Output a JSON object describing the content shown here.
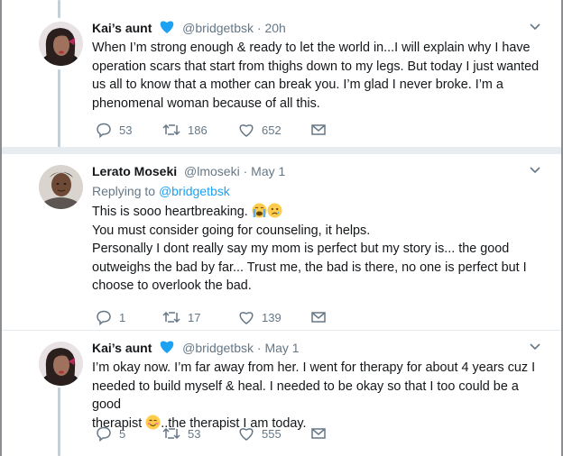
{
  "tweets": [
    {
      "author_name": "Kai’s aunt",
      "verified_badge_icon": "heart-icon",
      "handle": "@bridgetbsk",
      "separator": "·",
      "time": "20h",
      "lines": [
        "When I’m strong enough & ready to let the world in...I will explain why I have",
        "operation scars that start from thighs down to my legs. But today I just wanted",
        "us all to know that a mother can break you. I’m glad I never broke. I’m a",
        "phenomenal woman because of all this."
      ],
      "replies": "53",
      "retweets": "186",
      "likes": "652"
    },
    {
      "author_name": "Lerato Moseki",
      "handle": "@lmoseki",
      "separator": "·",
      "time": "May 1",
      "replying_prefix": "Replying to ",
      "replying_to": "@bridgetbsk",
      "line1": "This is sooo heartbreaking. ",
      "line1_emojis": [
        "crying-face",
        "sad-face"
      ],
      "lines": [
        "You must consider going for counseling, it helps.",
        "Personally I dont really say my mom is perfect but my story is... the good",
        "outweighs the bad by far... Trust me, the bad is there, no one is perfect but I",
        "choose to overlook the bad."
      ],
      "replies": "1",
      "retweets": "17",
      "likes": "139"
    },
    {
      "author_name": "Kai’s aunt",
      "verified_badge_icon": "heart-icon",
      "handle": "@bridgetbsk",
      "separator": "·",
      "time": "May 1",
      "lines": [
        "I’m okay now. I’m far away from her. I went for therapy for about 4 years cuz I",
        "needed to build myself & heal. I needed to be okay so that I too could be a good"
      ],
      "last_line_prefix": "therapist ",
      "last_line_emoji": "smiling-face",
      "last_line_suffix": "..the therapist I am today.",
      "replies": "5",
      "retweets": "53",
      "likes": "555"
    }
  ],
  "colors": {
    "text": "#14171a",
    "secondary": "#657786",
    "link": "#1da1f2",
    "badge": "#1da1f2",
    "divider": "#e6ecf0",
    "thread_line": "#c4cfd6"
  }
}
